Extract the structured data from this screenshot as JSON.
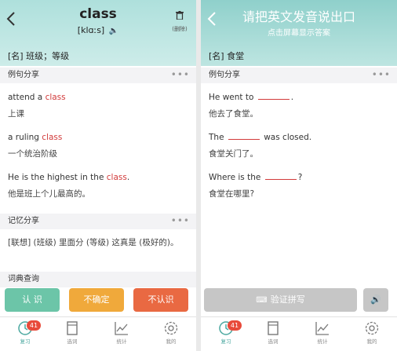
{
  "left": {
    "word": "class",
    "phonetic": "[klɑːs]",
    "delete_label": "(删除)",
    "meaning": "[名] 班级；等级",
    "examples_section": "例句分享",
    "examples": [
      {
        "pre": "attend a ",
        "word": "class",
        "post": "",
        "cn": "上课"
      },
      {
        "pre": "a ruling ",
        "word": "class",
        "post": "",
        "cn": "一个统治阶级"
      },
      {
        "pre": "He is the highest in the ",
        "word": "class",
        "post": ".",
        "cn": "他是班上个儿最高的。"
      }
    ],
    "memory_section": "记忆分享",
    "memory_text": "[联想] (班级) 里面分 (等级) 这真是 (极好的)。",
    "dict_section": "词典查询",
    "buttons": {
      "know": "认 识",
      "unsure": "不确定",
      "unknown": "不认识"
    }
  },
  "right": {
    "title": "请把英文发音说出口",
    "subtitle": "点击屏幕显示答案",
    "meaning": "[名] 食堂",
    "examples_section": "例句分享",
    "examples": [
      {
        "pre": "He went to ",
        "post": ".",
        "cn": "他去了食堂。"
      },
      {
        "pre": "The ",
        "post": " was closed.",
        "cn": "食堂关门了。"
      },
      {
        "pre": "Where is the ",
        "post": "?",
        "cn": "食堂在哪里?"
      }
    ],
    "verify_button": "验证拼写"
  },
  "tabs": [
    {
      "label": "复习",
      "badge": "41",
      "icon": "clock-icon"
    },
    {
      "label": "选词",
      "icon": "book-icon"
    },
    {
      "label": "统计",
      "icon": "chart-icon"
    },
    {
      "label": "我的",
      "icon": "gear-icon"
    }
  ],
  "colors": {
    "header": "#b8e4e0",
    "highlight": "#d23b3b",
    "know": "#6cc5a8",
    "unsure": "#f0a93b",
    "unknown": "#e96942",
    "disabled": "#c6c6c6"
  }
}
